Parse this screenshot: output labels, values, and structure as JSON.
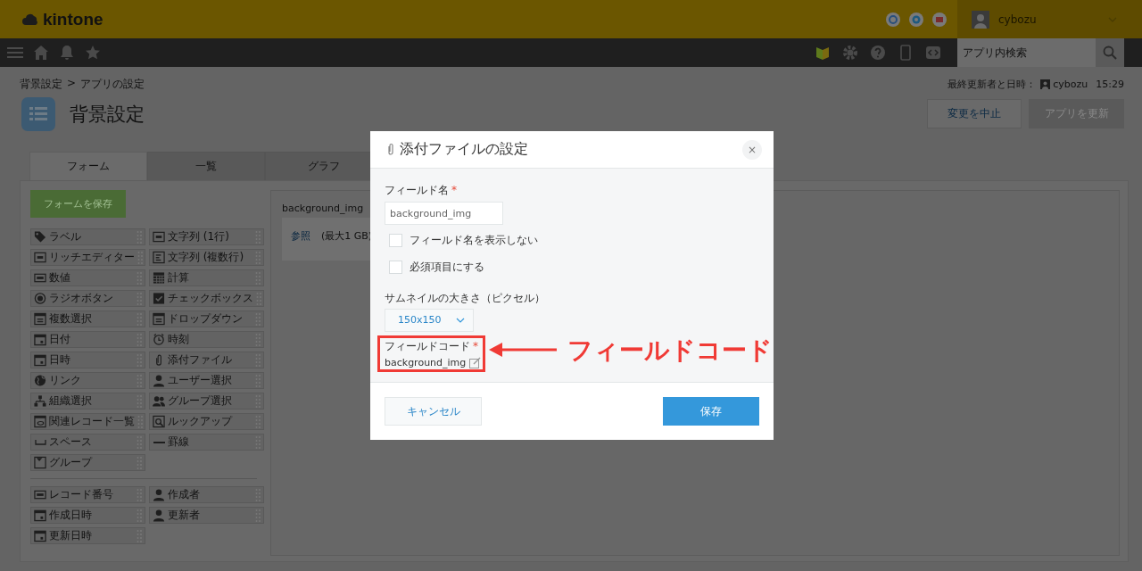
{
  "header": {
    "logo": "kintone",
    "user": "cybozu"
  },
  "navbar": {
    "search_placeholder": "アプリ内検索"
  },
  "breadcrumb": [
    "背景設定",
    "アプリの設定"
  ],
  "breadcrumb_separator": ">",
  "last_updated": {
    "label": "最終更新者と日時：",
    "user": "cybozu",
    "time": "15:29"
  },
  "app": {
    "title": "背景設定"
  },
  "header_buttons": [
    {
      "label": "変更を中止",
      "kind": "secondary"
    },
    {
      "label": "アプリを更新",
      "kind": "primary"
    }
  ],
  "tabs": [
    {
      "label": "フォーム",
      "selected": true
    },
    {
      "label": "一覧",
      "selected": false
    },
    {
      "label": "グラフ",
      "selected": false
    }
  ],
  "form_save_button": "フォームを保存",
  "palette_fields": [
    "ラベル",
    "文字列 (1行)",
    "リッチエディター",
    "文字列 (複数行)",
    "数値",
    "計算",
    "ラジオボタン",
    "チェックボックス",
    "複数選択",
    "ドロップダウン",
    "日付",
    "時刻",
    "日時",
    "添付ファイル",
    "リンク",
    "ユーザー選択",
    "組織選択",
    "グループ選択",
    "関連レコード一覧",
    "ルックアップ",
    "スペース",
    "罫線",
    "グループ"
  ],
  "palette_system": [
    "レコード番号",
    "作成者",
    "作成日時",
    "更新者",
    "更新日時"
  ],
  "canvas_field": {
    "label": "background_img",
    "link": "参照",
    "note": "(最大1 GB)"
  },
  "dialog": {
    "title": "添付ファイルの設定",
    "close": "×",
    "field_name": {
      "label": "フィールド名",
      "required_mark": "*",
      "value": "background_img"
    },
    "checkboxes": [
      {
        "label": "フィールド名を表示しない",
        "checked": false
      },
      {
        "label": "必須項目にする",
        "checked": false
      }
    ],
    "thumbnail": {
      "label": "サムネイルの大きさ（ピクセル）",
      "value": "150x150"
    },
    "field_code": {
      "label": "フィールドコード",
      "required_mark": "*",
      "value": "background_img"
    },
    "buttons": [
      {
        "label": "キャンセル",
        "kind": "cancel"
      },
      {
        "label": "保存",
        "kind": "save"
      }
    ]
  },
  "annotation": {
    "text": "フィールドコード"
  }
}
